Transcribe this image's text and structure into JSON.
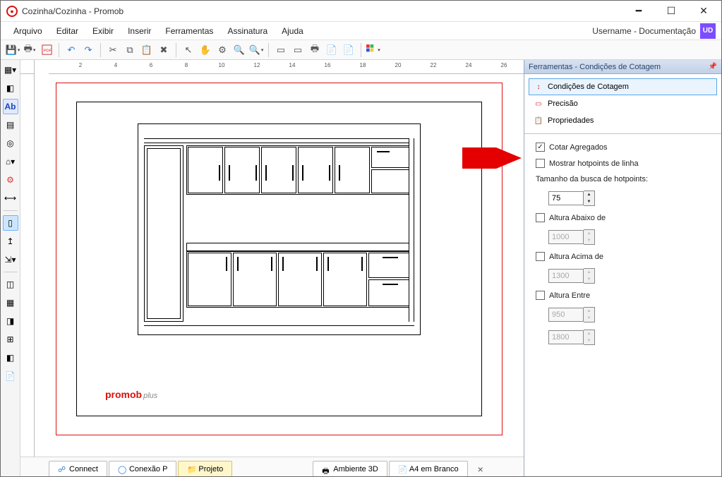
{
  "window": {
    "title": "Cozinha/Cozinha - Promob"
  },
  "menu": {
    "arquivo": "Arquivo",
    "editar": "Editar",
    "exibir": "Exibir",
    "inserir": "Inserir",
    "ferramentas": "Ferramentas",
    "assinatura": "Assinatura",
    "ajuda": "Ajuda"
  },
  "user": {
    "label": "Username - Documentação",
    "badge": "UD"
  },
  "ruler": {
    "h": [
      "2",
      "4",
      "6",
      "8",
      "10",
      "12",
      "14",
      "16",
      "18",
      "20",
      "22",
      "24",
      "26"
    ]
  },
  "brand": {
    "name": "promob",
    "suffix": "plus"
  },
  "tabs": {
    "connect": "Connect",
    "conexao": "Conexão P",
    "projeto": "Projeto",
    "ambiente": "Ambiente 3D",
    "a4": "A4 em Branco",
    "close": "×"
  },
  "panel": {
    "title": "Ferramentas - Condições de Cotagem",
    "sections": {
      "cond": "Condições de Cotagem",
      "prec": "Precisão",
      "prop": "Propriedades"
    }
  },
  "options": {
    "cotar": "Cotar Agregados",
    "mostrar": "Mostrar hotpoints de linha",
    "tamanho_label": "Tamanho da busca de hotpoints:",
    "tamanho_val": "75",
    "abaixo": "Altura Abaixo de",
    "abaixo_val": "1000",
    "acima": "Altura Acima de",
    "acima_val": "1300",
    "entre": "Altura Entre",
    "entre1_val": "950",
    "entre2_val": "1800"
  }
}
